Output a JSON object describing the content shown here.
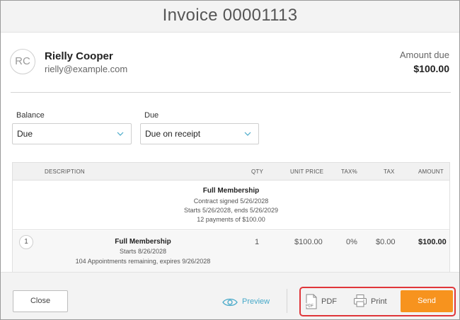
{
  "header": {
    "title": "Invoice 00001113"
  },
  "customer": {
    "initials": "RC",
    "name": "Rielly Cooper",
    "email": "rielly@example.com"
  },
  "amount_due": {
    "label": "Amount due",
    "value": "$100.00"
  },
  "filters": {
    "balance": {
      "label": "Balance",
      "value": "Due"
    },
    "due": {
      "label": "Due",
      "value": "Due on receipt"
    }
  },
  "table": {
    "columns": [
      "DESCRIPTION",
      "QTY",
      "UNIT PRICE",
      "TAX%",
      "TAX",
      "AMOUNT"
    ],
    "group": {
      "title": "Full Membership",
      "lines": [
        "Contract signed 5/26/2028",
        "Starts 5/26/2028, ends 5/26/2029",
        "12 payments of $100.00"
      ]
    },
    "rows": [
      {
        "num": "1",
        "description": "Full Membership",
        "sub1": "Starts 8/26/2028",
        "sub2": "104 Appointments remaining, expires 9/26/2028",
        "qty": "1",
        "unit_price": "$100.00",
        "tax_pct": "0%",
        "tax": "$0.00",
        "amount": "$100.00"
      }
    ]
  },
  "footer": {
    "close": "Close",
    "preview": "Preview",
    "pdf": "PDF",
    "print": "Print",
    "send": "Send"
  },
  "colors": {
    "accent": "#47a9c9",
    "send": "#f7931e",
    "highlight": "#e0363a"
  },
  "icons": {
    "preview": "eye-icon",
    "pdf": "pdf-file-icon",
    "print": "printer-icon",
    "chevron": "chevron-down-icon"
  }
}
